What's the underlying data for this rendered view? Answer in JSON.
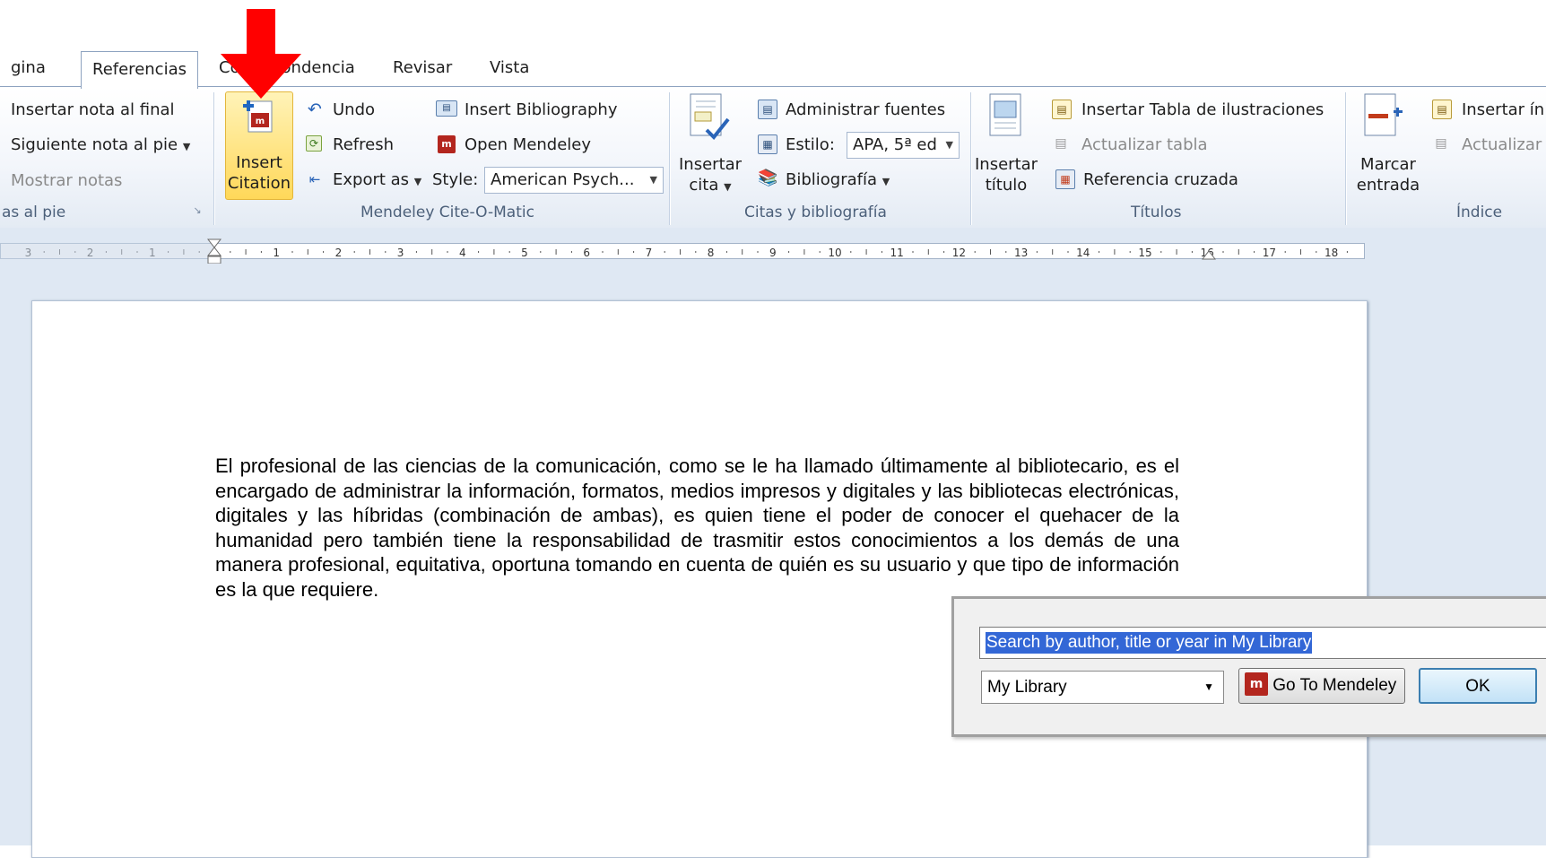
{
  "tabs": [
    {
      "label": "gina"
    },
    {
      "label": "Referencias"
    },
    {
      "label": "Correspondencia"
    },
    {
      "label": "Revisar"
    },
    {
      "label": "Vista"
    }
  ],
  "footnotes": {
    "insert_endnote": "Insertar nota al final",
    "next_footnote": "Siguiente nota al pie",
    "show_notes": "Mostrar notas",
    "group_label": "as al pie"
  },
  "mendeley": {
    "insert_citation_line1": "Insert",
    "insert_citation_line2": "Citation",
    "undo": "Undo",
    "refresh": "Refresh",
    "export_as": "Export as",
    "insert_bibliography": "Insert Bibliography",
    "open_mendeley": "Open Mendeley",
    "style_label": "Style:",
    "style_value": "American Psych...",
    "group_label": "Mendeley Cite-O-Matic"
  },
  "citations": {
    "insert_cite_line1": "Insertar",
    "insert_cite_line2": "cita",
    "manage_sources": "Administrar fuentes",
    "style_label": "Estilo:",
    "style_value": "APA, 5ª ed",
    "bibliography": "Bibliografía",
    "group_label": "Citas y bibliografía"
  },
  "captions": {
    "insert_caption_line1": "Insertar",
    "insert_caption_line2": "título",
    "insert_table_of_figures": "Insertar Tabla de ilustraciones",
    "update_table": "Actualizar tabla",
    "cross_reference": "Referencia cruzada",
    "group_label": "Títulos"
  },
  "index": {
    "mark_entry_line1": "Marcar",
    "mark_entry_line2": "entrada",
    "insert_index": "Insertar ín",
    "update": "Actualizar",
    "group_label": "Índice"
  },
  "ruler": {
    "labels": [
      "3",
      "2",
      "1",
      "1",
      "2",
      "3",
      "4",
      "5",
      "6",
      "7",
      "8",
      "9",
      "10",
      "11",
      "12",
      "13",
      "14",
      "15",
      "16",
      "17",
      "18"
    ]
  },
  "document": {
    "paragraph": "El profesional de las ciencias de la comunicación, como se le ha llamado últimamente al bibliotecario, es el encargado de administrar la información, formatos, medios impresos y digitales y las bibliotecas electrónicas, digitales y las híbridas (combinación de ambas), es quien tiene el poder de conocer el quehacer de la humanidad pero también tiene la responsabilidad de trasmitir estos conocimientos a los demás de una manera profesional, equitativa, oportuna tomando en cuenta de quién es su usuario y que tipo de información es la que requiere."
  },
  "popup": {
    "search_placeholder": "Search by author, title or year in My Library",
    "library_value": "My Library",
    "go_to_mendeley": "Go To Mendeley",
    "ok": "OK"
  },
  "colors": {
    "arrow": "#ff0000",
    "mendeley_red": "#b3261e",
    "highlight": "#ffd859",
    "selection": "#3367d6"
  }
}
